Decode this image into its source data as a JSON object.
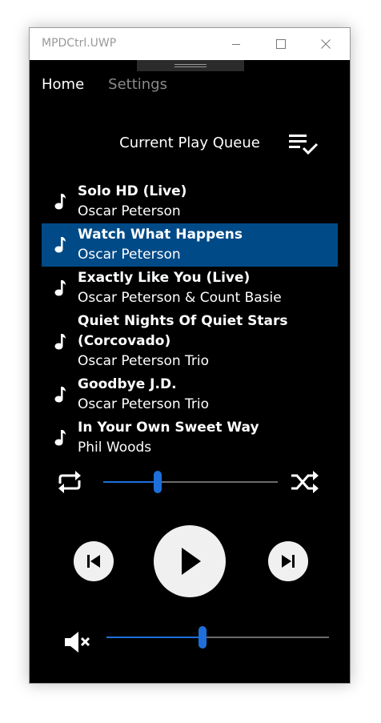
{
  "window": {
    "title": "MPDCtrl.UWP"
  },
  "nav": {
    "tabs": [
      {
        "label": "Home",
        "active": true
      },
      {
        "label": "Settings",
        "active": false
      }
    ]
  },
  "queue": {
    "title": "Current Play Queue",
    "items": [
      {
        "title": "Solo HD (Live)",
        "artist": "Oscar Peterson",
        "selected": false
      },
      {
        "title": "Watch What Happens",
        "artist": "Oscar Peterson",
        "selected": true
      },
      {
        "title": "Exactly Like You (Live)",
        "artist": "Oscar Peterson & Count Basie",
        "selected": false
      },
      {
        "title": "Quiet Nights Of Quiet Stars (Corcovado)",
        "artist": "Oscar Peterson Trio",
        "selected": false
      },
      {
        "title": "Goodbye J.D.",
        "artist": "Oscar Peterson Trio",
        "selected": false
      },
      {
        "title": "In Your Own Sweet Way",
        "artist": "Phil Woods",
        "selected": false
      }
    ]
  },
  "playback": {
    "seek_fraction": 0.31,
    "volume_fraction": 0.43
  },
  "colors": {
    "accent": "#1e6fd9",
    "selection": "#004a87",
    "background": "#000000"
  },
  "icons": {
    "repeat": "repeat-icon",
    "shuffle": "shuffle-icon",
    "previous": "previous-icon",
    "play": "play-icon",
    "next": "next-icon",
    "mute": "mute-icon",
    "queue": "queue-check-icon",
    "note": "music-note-icon"
  }
}
